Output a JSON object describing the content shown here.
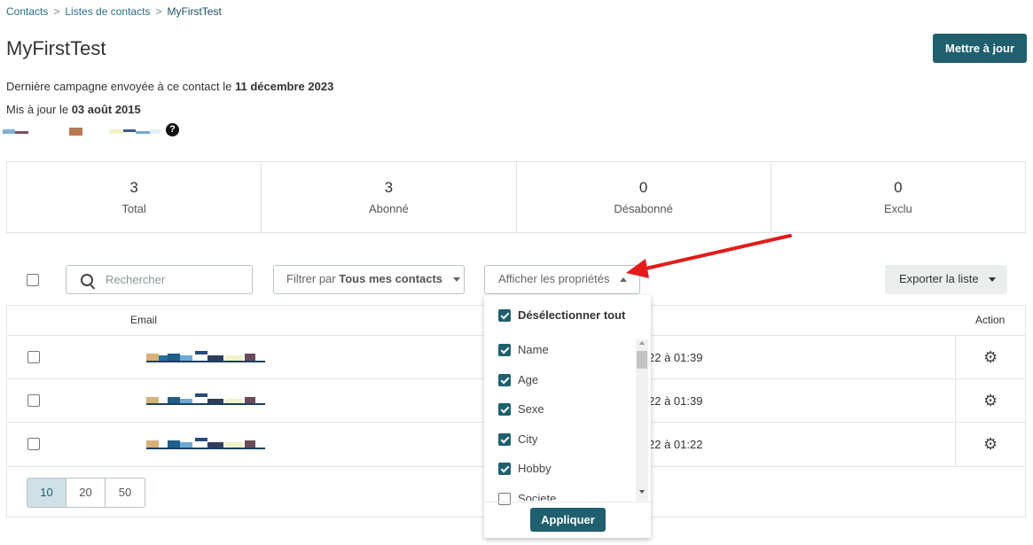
{
  "breadcrumb": {
    "item1": "Contacts",
    "item2": "Listes de contacts",
    "current": "MyFirstTest",
    "separator": ">"
  },
  "header": {
    "title": "MyFirstTest",
    "update_button": "Mettre à jour"
  },
  "info": {
    "campaign_prefix": "Dernière campagne envoyée à ce contact le",
    "campaign_date": "11 décembre 2023",
    "updated_prefix": "Mis à jour le",
    "updated_date": "03 août 2015",
    "help_symbol": "?"
  },
  "stats": [
    {
      "value": "3",
      "label": "Total"
    },
    {
      "value": "3",
      "label": "Abonné"
    },
    {
      "value": "0",
      "label": "Désabonné"
    },
    {
      "value": "0",
      "label": "Exclu"
    }
  ],
  "toolbar": {
    "search_placeholder": "Rechercher",
    "filter_prefix": "Filtrer par",
    "filter_value": "Tous mes contacts",
    "properties_label": "Afficher les propriétés",
    "export_label": "Exporter la liste"
  },
  "table": {
    "col_email": "Email",
    "col_action": "Action",
    "rows": [
      {
        "date": "22 à 01:39"
      },
      {
        "date": "22 à 01:39"
      },
      {
        "date": "22 à 01:22"
      }
    ]
  },
  "pagination": [
    "10",
    "20",
    "50"
  ],
  "properties_dropdown": {
    "deselect_all": "Désélectionner tout",
    "items": [
      {
        "label": "Name",
        "checked": true
      },
      {
        "label": "Age",
        "checked": true
      },
      {
        "label": "Sexe",
        "checked": true
      },
      {
        "label": "City",
        "checked": true
      },
      {
        "label": "Hobby",
        "checked": true
      },
      {
        "label": "Societe",
        "checked": false
      }
    ],
    "apply_label": "Appliquer"
  },
  "colors": {
    "primary": "#1f5f6e",
    "arrow": "#e31b1b",
    "link": "#2b6f86"
  },
  "icons": [
    "search-icon",
    "gear-icon",
    "help-icon",
    "caret-down-icon",
    "caret-up-icon",
    "check-icon"
  ]
}
